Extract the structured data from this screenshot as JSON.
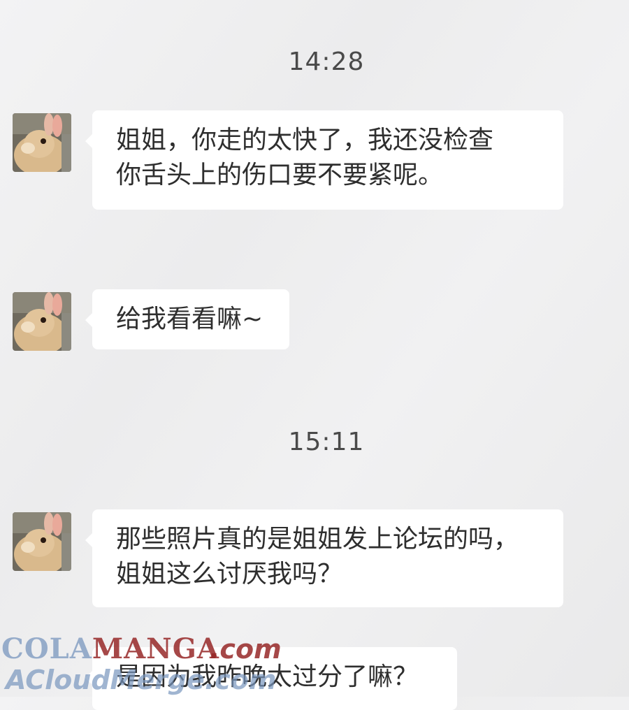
{
  "timestamps": [
    "14:28",
    "15:11"
  ],
  "messages": [
    {
      "lines": [
        "姐姐，你走的太快了，我还没检查",
        "你舌头上的伤口要不要紧呢。"
      ]
    },
    {
      "lines": [
        "给我看看嘛~"
      ]
    },
    {
      "lines": [
        "那些照片真的是姐姐发上论坛的吗，",
        "姐姐这么讨厌我吗？"
      ]
    },
    {
      "lines": [
        "是因为我昨晚太过分了嘛？"
      ]
    }
  ],
  "avatar": {
    "icon": "rabbit-avatar-icon"
  },
  "colors": {
    "background": "#efeff0",
    "bubble": "#ffffff",
    "text": "#2e2e2e",
    "timestamp": "#4a4a4a"
  },
  "watermark": {
    "cola": "COLA",
    "manga": "MANGA",
    "com": ".com",
    "domain": "ACloudMerge.com"
  }
}
